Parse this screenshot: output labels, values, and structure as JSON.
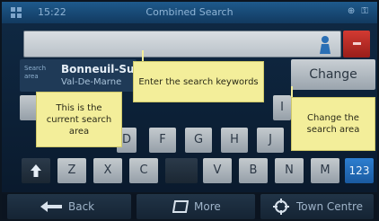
{
  "status_bar": {
    "time": "15:22",
    "title": "Combined Search",
    "icons": "⊕ ⚿"
  },
  "search": {
    "value": "",
    "placeholder": ""
  },
  "search_area": {
    "label": "Search area",
    "city": "Bonneuil-Su",
    "region": "Val-De-Marne"
  },
  "change_button": "Change",
  "keyboard": {
    "row2_visible": [
      "I"
    ],
    "row3": [
      "D",
      "F",
      "G",
      "H",
      "J"
    ],
    "row4": [
      "Z",
      "X",
      "C",
      "",
      "V",
      "B",
      "N",
      "M"
    ],
    "shift_icon": "shift-arrow-icon",
    "numbers_key": "123"
  },
  "callouts": {
    "keywords": "Enter the search keywords",
    "current_area": "This is the current search area",
    "change_area": "Change the search area"
  },
  "bottom_bar": {
    "back": "Back",
    "more": "More",
    "town_centre": "Town Centre"
  },
  "colors": {
    "accent_red": "#c4302a",
    "accent_blue": "#2270c0",
    "callout_yellow": "#f3ee9a"
  }
}
